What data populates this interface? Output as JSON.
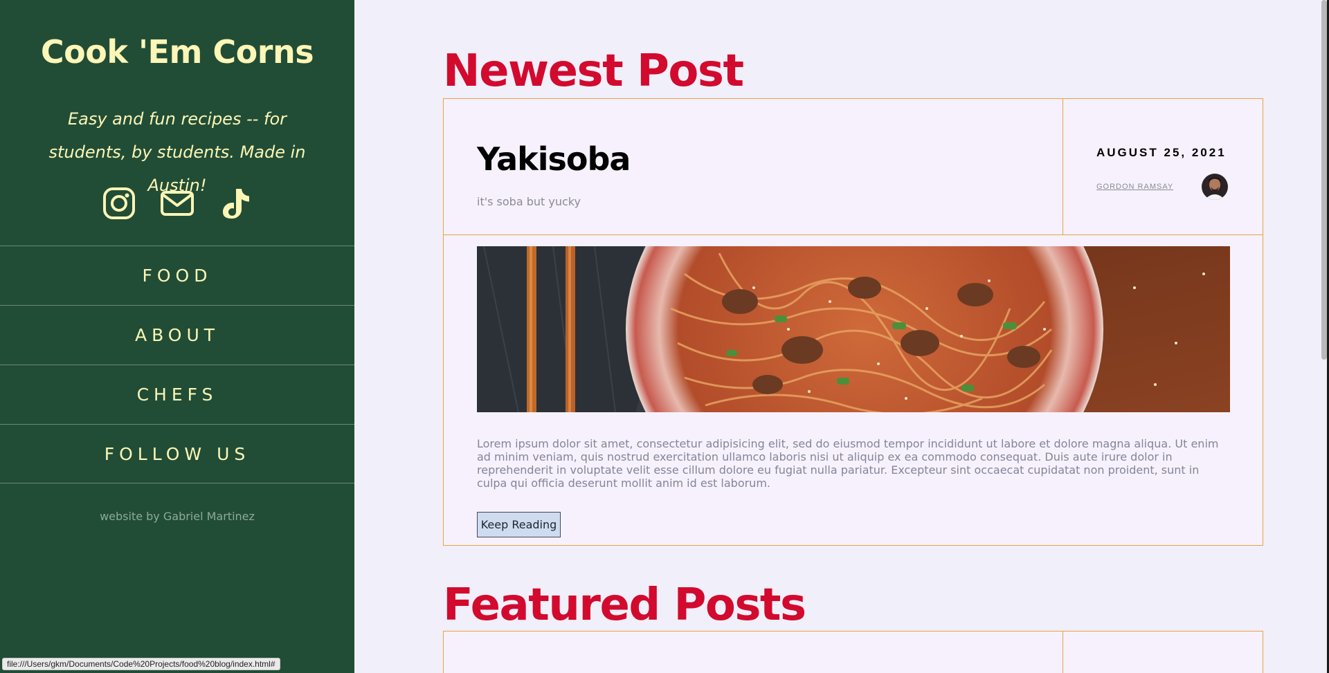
{
  "sidebar": {
    "title": "Cook 'Em Corns",
    "tagline": "Easy and fun recipes -- for students, by students. Made in Austin!",
    "social": [
      {
        "icon": "instagram-icon"
      },
      {
        "icon": "envelope-icon"
      },
      {
        "icon": "tiktok-icon"
      }
    ],
    "nav": [
      "FOOD",
      "ABOUT",
      "CHEFS",
      "FOLLOW US"
    ],
    "credit": "website by Gabriel Martinez"
  },
  "status_bar": {
    "url": "file:///Users/gkm/Documents/Code%20Projects/food%20blog/index.html#"
  },
  "newest": {
    "heading": "Newest Post",
    "post": {
      "title": "Yakisoba",
      "subtitle": "it's soba but yucky",
      "date": "AUGUST 25, 2021",
      "author": "GORDON RAMSAY",
      "body": "Lorem ipsum dolor sit amet, consectetur adipisicing elit, sed do eiusmod tempor incididunt ut labore et dolore magna aliqua. Ut enim ad minim veniam, quis nostrud exercitation ullamco laboris nisi ut aliquip ex ea commodo consequat. Duis aute irure dolor in reprehenderit in voluptate velit esse cillum dolore eu fugiat nulla pariatur. Excepteur sint occaecat cupidatat non proident, sunt in culpa qui officia deserunt mollit anim id est laborum.",
      "button": "Keep Reading"
    }
  },
  "featured": {
    "heading": "Featured Posts"
  },
  "colors": {
    "sidebar_bg": "#214d36",
    "sidebar_text": "#fdf6b6",
    "heading_red": "#d20a2e",
    "card_border": "#e3a445",
    "page_bg": "#f1eff9"
  }
}
